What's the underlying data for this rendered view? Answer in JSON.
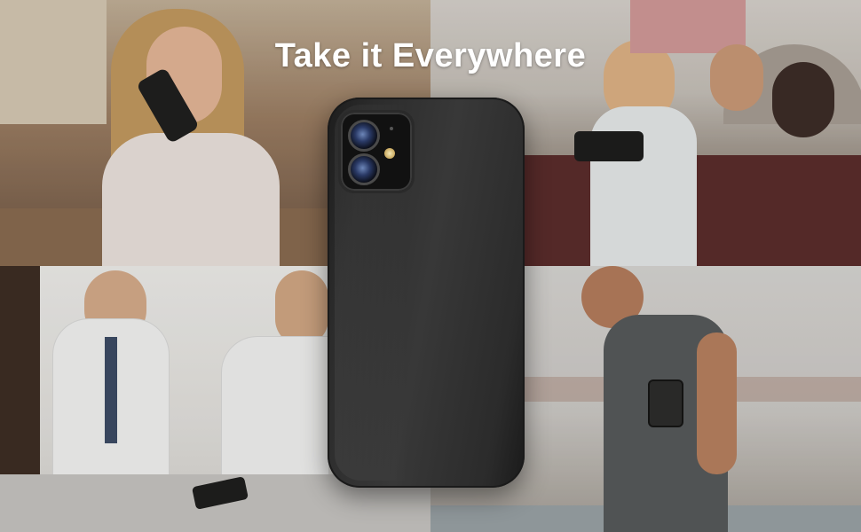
{
  "banner": {
    "headline": "Take it Everywhere"
  },
  "product": {
    "case_color": "#2e2e2e"
  }
}
